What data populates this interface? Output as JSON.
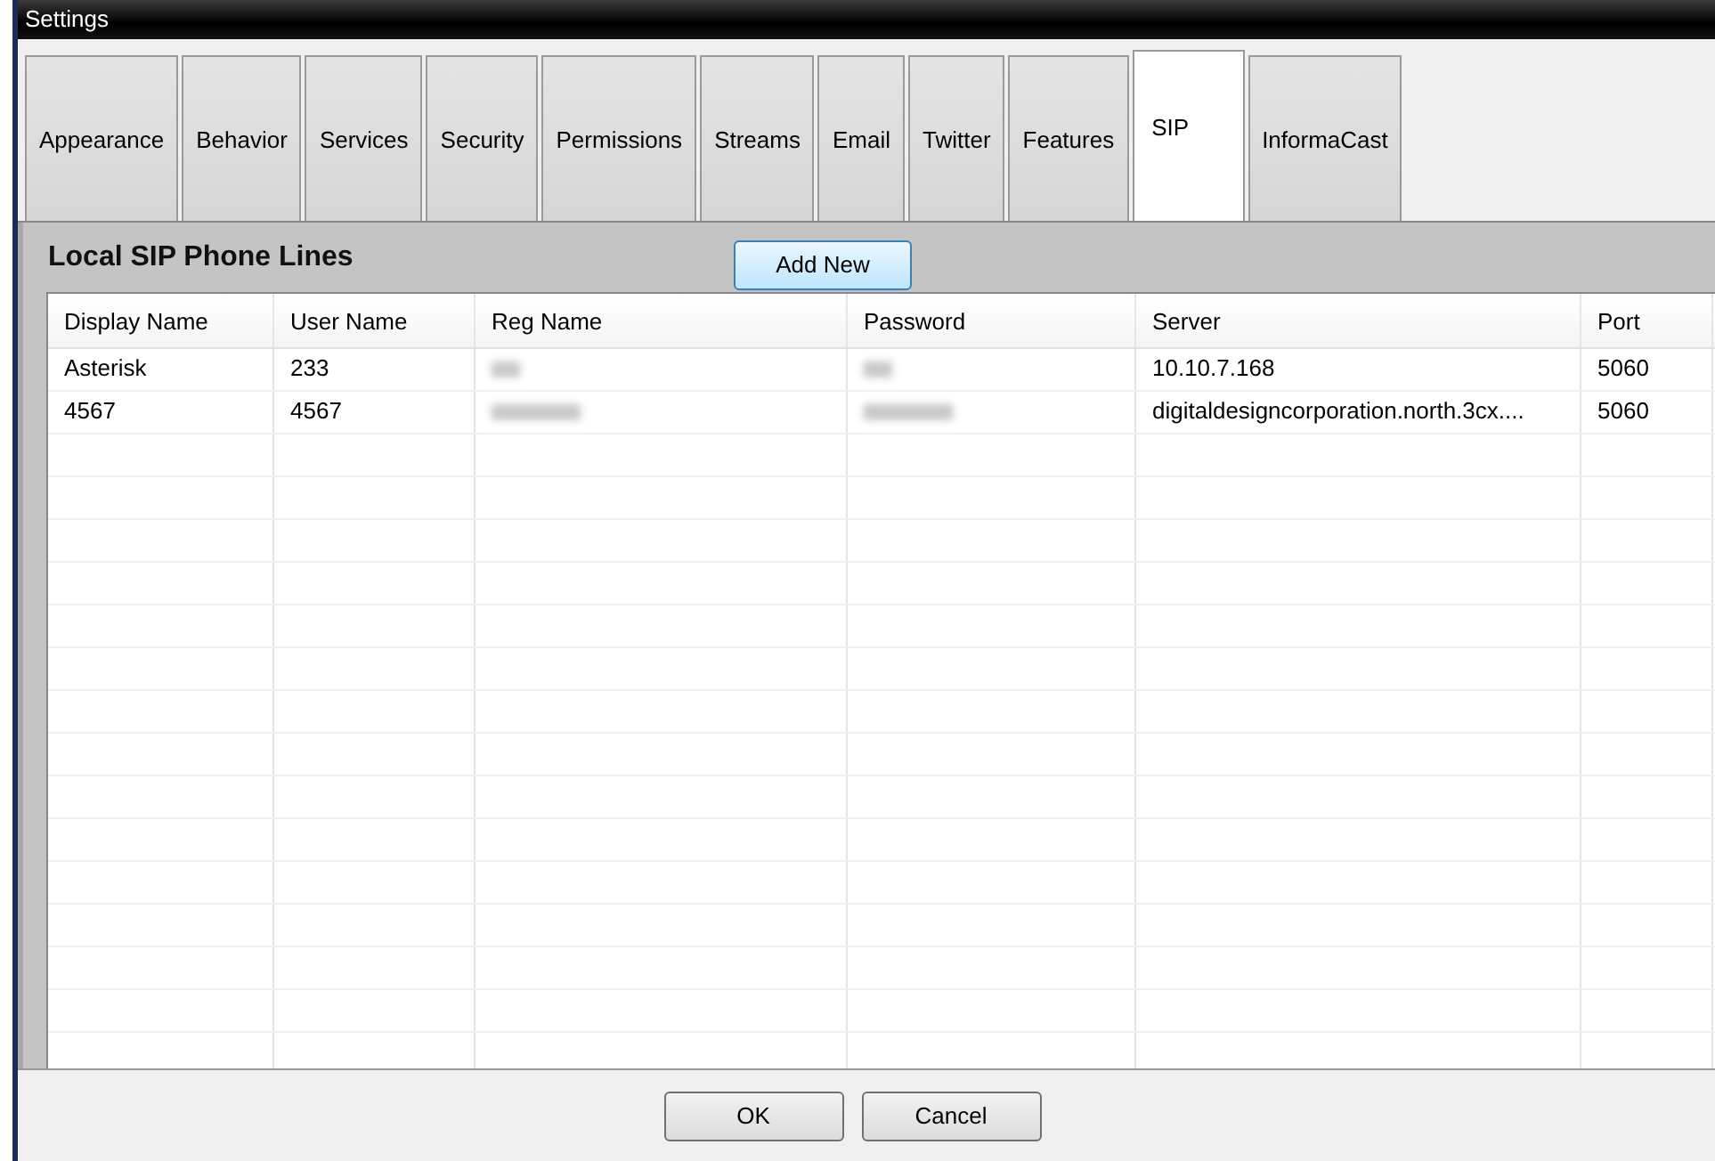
{
  "window": {
    "title": "Settings"
  },
  "tabs": [
    {
      "label": "Appearance",
      "selected": false
    },
    {
      "label": "Behavior",
      "selected": false
    },
    {
      "label": "Services",
      "selected": false
    },
    {
      "label": "Security",
      "selected": false
    },
    {
      "label": "Permissions",
      "selected": false
    },
    {
      "label": "Streams",
      "selected": false
    },
    {
      "label": "Email",
      "selected": false
    },
    {
      "label": "Twitter",
      "selected": false
    },
    {
      "label": "Features",
      "selected": false
    },
    {
      "label": "SIP",
      "selected": true
    },
    {
      "label": "InformaCast",
      "selected": false
    }
  ],
  "panel": {
    "title": "Local SIP Phone Lines",
    "add_button": "Add New"
  },
  "table": {
    "columns": [
      "Display Name",
      "User Name",
      "Reg Name",
      "Password",
      "Server",
      "Port"
    ],
    "rows": [
      {
        "cells": [
          {
            "kind": "text",
            "text": "Asterisk"
          },
          {
            "kind": "text",
            "text": "233"
          },
          {
            "kind": "redacted"
          },
          {
            "kind": "redacted"
          },
          {
            "kind": "text",
            "text": "10.10.7.168"
          },
          {
            "kind": "text",
            "text": "5060"
          }
        ]
      },
      {
        "cells": [
          {
            "kind": "text",
            "text": "4567"
          },
          {
            "kind": "text",
            "text": "4567"
          },
          {
            "kind": "redacted"
          },
          {
            "kind": "redacted"
          },
          {
            "kind": "text",
            "text": "digitaldesigncorporation.north.3cx...."
          },
          {
            "kind": "text",
            "text": "5060"
          }
        ]
      }
    ]
  },
  "buttons": [
    "OK",
    "Cancel"
  ]
}
